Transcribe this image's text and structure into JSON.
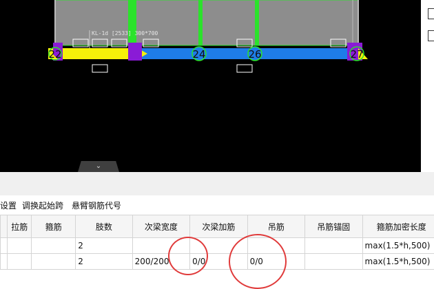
{
  "drawing": {
    "beam_label": "KL-1d [2533] 300*700",
    "axis_nodes": [
      "22",
      "24",
      "26",
      "27"
    ]
  },
  "collapse_icon": "chevron-down-icon",
  "toolbar": {
    "items": [
      "设置",
      "调换起始跨",
      "悬臂钢筋代号"
    ]
  },
  "table": {
    "headers": [
      "拉筋",
      "箍筋",
      "肢数",
      "次梁宽度",
      "次梁加筋",
      "吊筋",
      "吊筋锚固",
      "箍筋加密长度"
    ],
    "rows": [
      [
        "",
        "",
        "2",
        "",
        "",
        "",
        "",
        "max(1.5*h,500)"
      ],
      [
        "",
        "",
        "2",
        "200/200",
        "0/0",
        "0/0",
        "",
        "max(1.5*h,500)"
      ]
    ]
  },
  "colors": {
    "beam_blue": "#1e7de8",
    "beam_yellow": "#f5f10a",
    "column_purple": "#8a1bd6",
    "column_green": "#2be32b",
    "annotation_red": "#e03a3a"
  }
}
